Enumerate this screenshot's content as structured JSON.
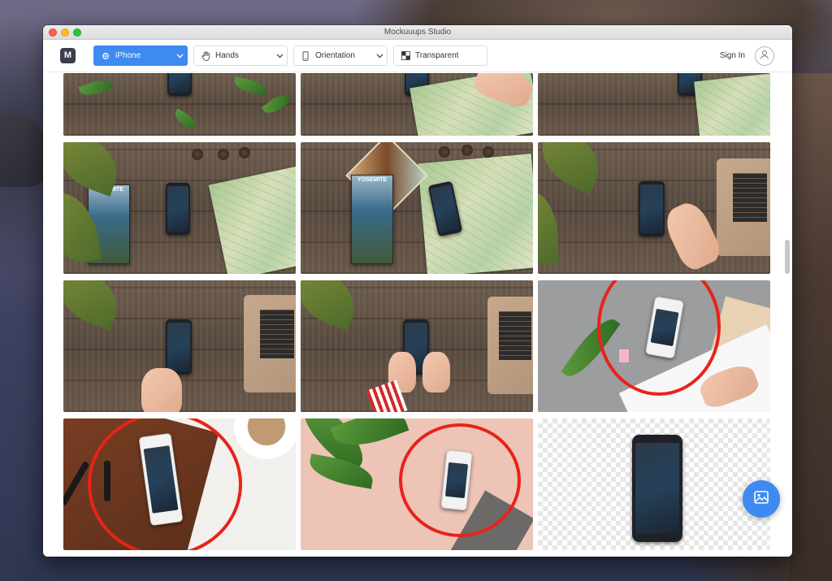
{
  "window": {
    "title": "Mockuuups Studio"
  },
  "toolbar": {
    "logo_letter": "M",
    "device_dropdown": {
      "label": "iPhone",
      "icon": "iphone-gear-icon"
    },
    "hands_dropdown": {
      "label": "Hands",
      "icon": "hand-icon"
    },
    "orientation_dropdown": {
      "label": "Orientation",
      "icon": "phone-portrait-icon"
    },
    "background_dropdown": {
      "label": "Transparent",
      "icon": "checkerboard-icon"
    },
    "sign_in_label": "Sign In",
    "avatar_icon": "user-icon"
  },
  "gallery": {
    "rows": [
      [
        "Plants on wood desk",
        "Map with hand and pen",
        "Map on wood desk"
      ],
      [
        "Book, pinecones and map",
        "Yosemite book and map",
        "Hand tapping near laptop"
      ],
      [
        "Hand near laptop",
        "Two hands holding phone",
        "White phone on grey paper"
      ],
      [
        "White phone on leather desk",
        "White phone on pink background",
        "Transparent background"
      ]
    ],
    "book_title": "YOSEMITE"
  },
  "fab_icon": "image-icon",
  "colors": {
    "accent": "#3d8bf2",
    "highlight_circle": "#e8231a"
  }
}
